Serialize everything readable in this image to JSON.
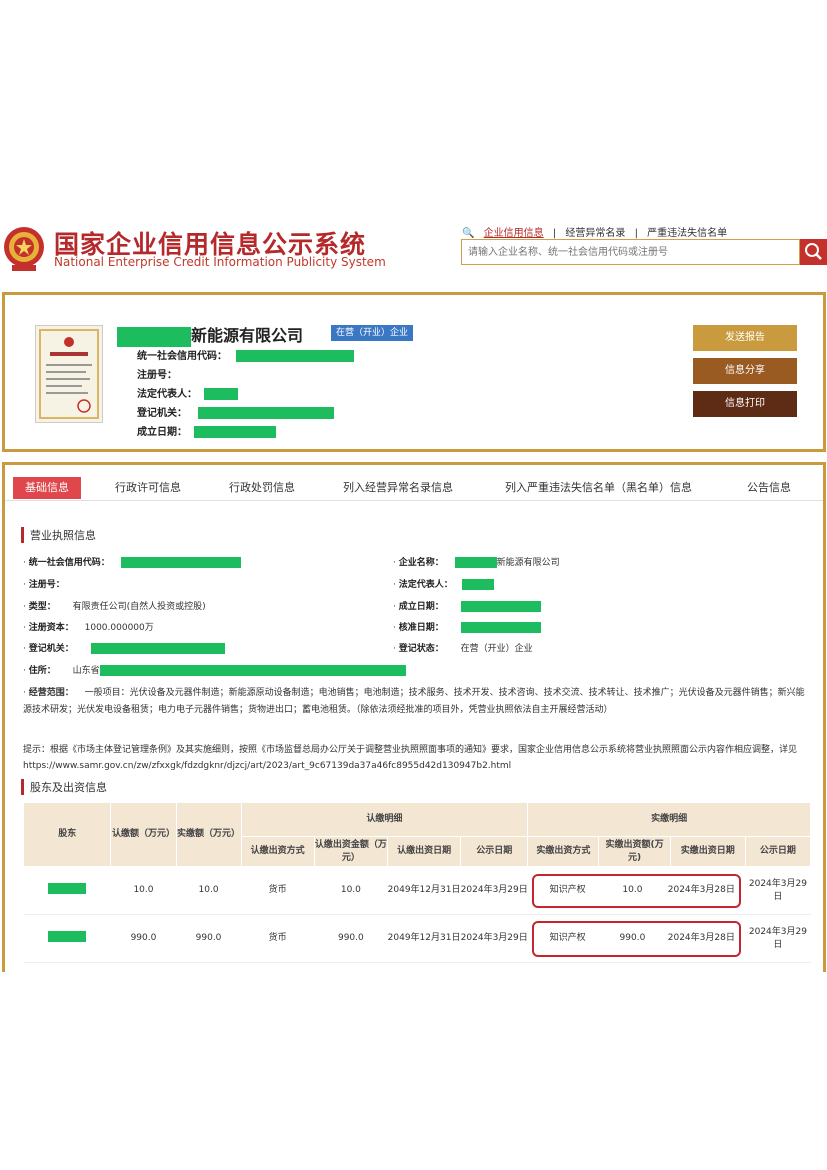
{
  "header": {
    "title_cn": "国家企业信用信息公示系统",
    "title_en": "National Enterprise Credit Information Publicity System",
    "nav": [
      "企业信用信息",
      "经营异常名录",
      "严重违法失信名单"
    ],
    "search_placeholder": "请输入企业名称、统一社会信用代码或注册号"
  },
  "company": {
    "name_suffix": "新能源有限公司",
    "status": "在营（开业）企业",
    "labels": {
      "credit_code": "统一社会信用代码：",
      "reg_no": "注册号：",
      "legal_rep": "法定代表人：",
      "authority": "登记机关：",
      "founded": "成立日期："
    },
    "buttons": {
      "send_report": "发送报告",
      "share": "信息分享",
      "print": "信息打印"
    }
  },
  "tabs": [
    "基础信息",
    "行政许可信息",
    "行政处罚信息",
    "列入经营异常名录信息",
    "列入严重违法失信名单（黑名单）信息",
    "公告信息"
  ],
  "license_section": {
    "title": "营业执照信息",
    "credit_code_label": "统一社会信用代码：",
    "reg_no_label": "注册号：",
    "type_label": "类型：",
    "type_value": "有限责任公司(自然人投资或控股)",
    "capital_label": "注册资本：",
    "capital_value": "1000.000000万",
    "authority_label": "登记机关：",
    "address_label": "住所：",
    "address_prefix": "山东省",
    "name_label": "企业名称：",
    "name_suffix": "新能源有限公司",
    "legal_rep_label": "法定代表人：",
    "founded_label": "成立日期：",
    "approved_label": "核准日期：",
    "status_label": "登记状态：",
    "status_value": "在营（开业）企业",
    "scope_label": "经营范围：",
    "scope_value": "一般项目：光伏设备及元器件制造；新能源原动设备制造；电池销售；电池制造；技术服务、技术开发、技术咨询、技术交流、技术转让、技术推广；光伏设备及元器件销售；新兴能源技术研发；光伏发电设备租赁；电力电子元器件销售；货物进出口；蓄电池租赁。（除依法须经批准的项目外，凭营业执照依法自主开展经营活动）",
    "notice": "提示：根据《市场主体登记管理条例》及其实施细则，按照《市场监督总局办公厅关于调整营业执照照面事项的通知》要求，国家企业信用信息公示系统将营业执照照面公示内容作相应调整，详见https://www.samr.gov.cn/zw/zfxxgk/fdzdgknr/djzcj/art/2023/art_9c67139da37a46fc8955d42d130947b2.html"
  },
  "shareholder_section": {
    "title": "股东及出资信息",
    "headers": {
      "shareholder": "股东",
      "subscribed": "认缴额（万元）",
      "paid": "实缴额（万元）",
      "sub_detail": "认缴明细",
      "paid_detail": "实缴明细",
      "sub_method": "认缴出资方式",
      "sub_amount": "认缴出资金额（万元）",
      "sub_date": "认缴出资日期",
      "pub_date": "公示日期",
      "paid_method": "实缴出资方式",
      "paid_amount": "实缴出资额(万元)",
      "paid_date": "实缴出资日期",
      "pub_date2": "公示日期"
    },
    "rows": [
      {
        "subscribed": "10.0",
        "paid": "10.0",
        "sub_method": "货币",
        "sub_amount": "10.0",
        "sub_date": "2049年12月31日",
        "pub_date": "2024年3月29日",
        "paid_method": "知识产权",
        "paid_amount": "10.0",
        "paid_date": "2024年3月28日",
        "pub_date2": "2024年3月29日"
      },
      {
        "subscribed": "990.0",
        "paid": "990.0",
        "sub_method": "货币",
        "sub_amount": "990.0",
        "sub_date": "2049年12月31日",
        "pub_date": "2024年3月29日",
        "paid_method": "知识产权",
        "paid_amount": "990.0",
        "paid_date": "2024年3月28日",
        "pub_date2": "2024年3月29日"
      }
    ]
  },
  "colors": {
    "brand_red": "#b5292b",
    "gold_border": "#c99a3e",
    "redaction_green": "#1dbc5f",
    "status_blue": "#3a77c5"
  }
}
